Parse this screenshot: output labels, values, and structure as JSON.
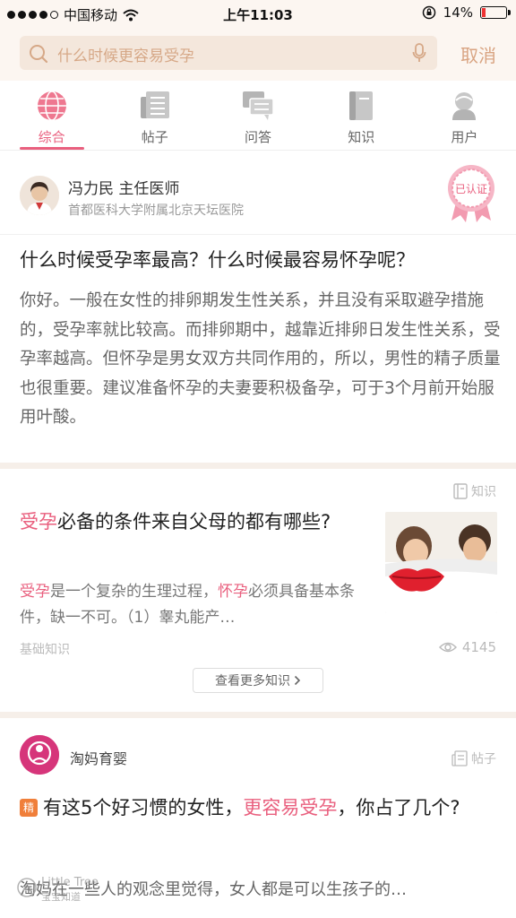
{
  "status_bar": {
    "carrier": "中国移动",
    "time": "上午11:03",
    "battery": "14%",
    "battery_level": 0.14
  },
  "search": {
    "placeholder": "什么时候更容易受孕",
    "cancel_label": "取消"
  },
  "tabs": [
    {
      "label": "综合",
      "icon": "globe-icon",
      "active": true
    },
    {
      "label": "帖子",
      "icon": "post-icon",
      "active": false
    },
    {
      "label": "问答",
      "icon": "chat-icon",
      "active": false
    },
    {
      "label": "知识",
      "icon": "book-icon",
      "active": false
    },
    {
      "label": "用户",
      "icon": "user-icon",
      "active": false
    }
  ],
  "qa": {
    "doctor_name": "冯力民 主任医师",
    "hospital": "首都医科大学附属北京天坛医院",
    "badge": "已认证",
    "question": "什么时候受孕率最高？什么时候最容易怀孕呢？",
    "answer": "你好。一般在女性的排卵期发生性关系，并且没有采取避孕措施的，受孕率就比较高。而排卵期中，越靠近排卵日发生性关系，受孕率越高。但怀孕是男女双方共同作用的，所以，男性的精子质量也很重要。建议准备怀孕的夫妻要积极备孕，可于3个月前开始服用叶酸。"
  },
  "knowledge": {
    "tag": "知识",
    "title_hl": "受孕",
    "title_rest": "必备的条件来自父母的都有哪些?",
    "summary_hl1": "受孕",
    "summary_mid": "是一个复杂的生理过程，",
    "summary_hl2": "怀孕",
    "summary_rest": "必须具备基本条件，缺一不可。（1）睾丸能产…",
    "category": "基础知识",
    "views": "4145",
    "more_label": "查看更多知识"
  },
  "post": {
    "author": "淘妈育婴",
    "tag": "帖子",
    "badge": "精",
    "title_pre": "有这5个好习惯的女性，",
    "title_hl": "更容易受孕",
    "title_post": "，你占了几个?",
    "summary": "淘妈在一些人的观念里觉得，女人都是可以生孩子的…",
    "watermark": "Little Tree 宝宝知道"
  },
  "colors": {
    "accent": "#e95f7e",
    "search_bg": "#f4e7dc",
    "header_bg": "#fcf6f1"
  }
}
